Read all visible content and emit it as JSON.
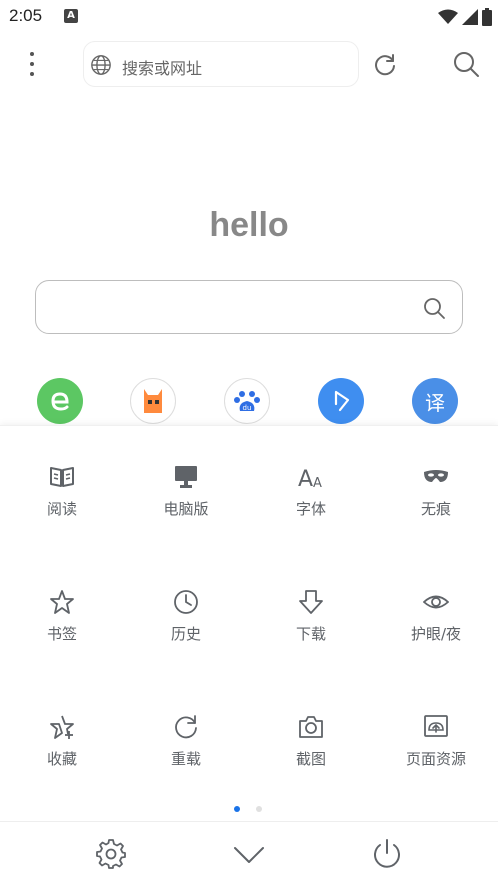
{
  "status_bar": {
    "time": "2:05",
    "app_icon": "A"
  },
  "toolbar": {
    "menu_icon": "more-vertical-icon",
    "address_placeholder": "搜索或网址",
    "globe_icon": "globe-icon",
    "refresh_icon": "refresh-icon",
    "search_icon": "search-icon"
  },
  "home": {
    "title": "hello",
    "shortcuts": [
      {
        "icon": "e-browser-icon",
        "color": "#5cc763"
      },
      {
        "icon": "llama-icon",
        "color": "#ff8a3d"
      },
      {
        "icon": "baidu-paw-icon",
        "color": "#2f6ee4"
      },
      {
        "icon": "arrow-cursor-icon",
        "color": "#3f8ef0"
      },
      {
        "icon": "translate-icon",
        "color": "#4a8fe7",
        "text": "译"
      }
    ]
  },
  "menu": {
    "items": [
      {
        "label": "阅读",
        "icon": "book-icon"
      },
      {
        "label": "电脑版",
        "icon": "monitor-icon"
      },
      {
        "label": "字体",
        "icon": "font-icon"
      },
      {
        "label": "无痕",
        "icon": "mask-icon"
      },
      {
        "label": "书签",
        "icon": "star-icon"
      },
      {
        "label": "历史",
        "icon": "clock-icon"
      },
      {
        "label": "下载",
        "icon": "download-arrow-icon"
      },
      {
        "label": "护眼/夜",
        "icon": "eye-icon"
      },
      {
        "label": "收藏",
        "icon": "star-plus-icon"
      },
      {
        "label": "重载",
        "icon": "reload-icon"
      },
      {
        "label": "截图",
        "icon": "camera-icon"
      },
      {
        "label": "页面资源",
        "icon": "image-resource-icon"
      }
    ],
    "page_indicator": {
      "pages": 2,
      "current": 1
    }
  },
  "bottom_bar": {
    "settings_icon": "gear-icon",
    "collapse_icon": "chevron-down-icon",
    "power_icon": "power-icon"
  },
  "colors": {
    "accent": "#1a73e8",
    "icon_gray": "#5f6368"
  }
}
